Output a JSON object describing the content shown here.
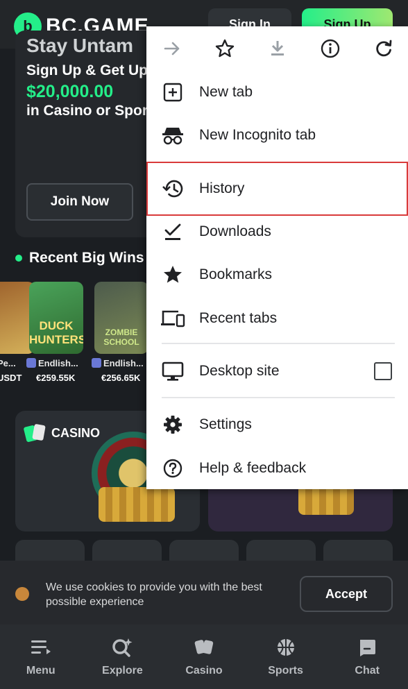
{
  "site": {
    "logo_text": "BC.GAME",
    "signin_label": "Sign In",
    "signup_label": "Sign Up",
    "hero": {
      "title": "Stay Untam",
      "line1": "Sign Up & Get Up",
      "amount": "$20,000.00",
      "line2": "in Casino or Spor",
      "join_label": "Join Now"
    },
    "recent_wins": {
      "heading": "Recent Big Wins",
      "cards": [
        {
          "title": "",
          "user": "Pe...",
          "amount": "USDT"
        },
        {
          "title": "DUCK HUNTERS",
          "user": "Endlish...",
          "amount": "€259.55K"
        },
        {
          "title": "ZOMBIE SCHOOL",
          "user": "Endlish...",
          "amount": "€256.65K"
        }
      ]
    },
    "casino_label": "CASINO",
    "cookie": {
      "text": "We use cookies to provide you with the best possible experience",
      "accept_label": "Accept"
    },
    "bottom_nav": [
      {
        "label": "Menu",
        "icon": "menu-icon"
      },
      {
        "label": "Explore",
        "icon": "explore-icon"
      },
      {
        "label": "Casino",
        "icon": "casino-cards-icon"
      },
      {
        "label": "Sports",
        "icon": "basketball-icon"
      },
      {
        "label": "Chat",
        "icon": "chat-icon"
      }
    ]
  },
  "chrome_menu": {
    "toolbar_icons": [
      "forward-icon",
      "star-icon",
      "download-icon",
      "info-icon",
      "refresh-icon"
    ],
    "items": {
      "new_tab": "New tab",
      "incognito": "New Incognito tab",
      "history": "History",
      "downloads": "Downloads",
      "bookmarks": "Bookmarks",
      "recent_tabs": "Recent tabs",
      "desktop_site": "Desktop site",
      "settings": "Settings",
      "help": "Help & feedback"
    },
    "desktop_site_checked": false,
    "highlight_color": "#d93a3a"
  }
}
